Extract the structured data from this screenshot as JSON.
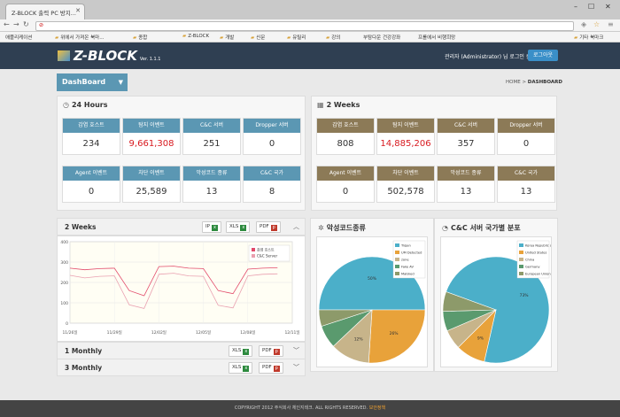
{
  "browser": {
    "tab_title": "Z-BLOCK 출력 PC 방지...",
    "address": "",
    "bookmarks": [
      {
        "label": "애플리케이션",
        "folder": false
      },
      {
        "label": "위에서 가져온 북마...",
        "folder": true
      },
      {
        "label": "종합",
        "folder": true
      },
      {
        "label": "Z-BLOCK",
        "folder": true
      },
      {
        "label": "개발",
        "folder": true
      },
      {
        "label": "신문",
        "folder": true
      },
      {
        "label": "유틸리",
        "folder": true
      },
      {
        "label": "강의",
        "folder": true
      },
      {
        "label": "부탐다운 건강강좌",
        "folder": false
      },
      {
        "label": "프롤에서 비행희망",
        "folder": false
      }
    ],
    "other_bookmarks": "기타 북마크"
  },
  "header": {
    "logo": "Z-BLOCK",
    "version": "Ver. 1.1.1",
    "admin_text": "관리자 (Administrator) 님 로그인 중",
    "logout_label": "로그아웃"
  },
  "nav": {
    "dashboard_label": "DashBoard",
    "breadcrumb_home": "HOME",
    "breadcrumb_sep": ">",
    "breadcrumb_current": "DASHBOARD"
  },
  "hours24": {
    "title": "24 Hours",
    "cards": [
      {
        "label": "감염 호스트",
        "value": "234",
        "red": false
      },
      {
        "label": "탐지 이벤트",
        "value": "9,661,308",
        "red": true
      },
      {
        "label": "C&C 서버",
        "value": "251",
        "red": false
      },
      {
        "label": "Dropper 서버",
        "value": "0",
        "red": false
      },
      {
        "label": "Agent 이벤트",
        "value": "0",
        "red": false
      },
      {
        "label": "차단 이벤트",
        "value": "25,589",
        "red": false
      },
      {
        "label": "악성코드 종류",
        "value": "13",
        "red": false
      },
      {
        "label": "C&C 국가",
        "value": "8",
        "red": false
      }
    ]
  },
  "weeks2": {
    "title": "2 Weeks",
    "cards": [
      {
        "label": "감염 호스트",
        "value": "808",
        "red": false
      },
      {
        "label": "탐지 이벤트",
        "value": "14,885,206",
        "red": true
      },
      {
        "label": "C&C 서버",
        "value": "357",
        "red": false
      },
      {
        "label": "Dropper 서버",
        "value": "0",
        "red": false
      },
      {
        "label": "Agent 이벤트",
        "value": "0",
        "red": false
      },
      {
        "label": "차단 이벤트",
        "value": "502,578",
        "red": false
      },
      {
        "label": "악성코드 종류",
        "value": "13",
        "red": false
      },
      {
        "label": "C&C 국가",
        "value": "13",
        "red": false
      }
    ]
  },
  "trend": {
    "title": "2 Weeks",
    "buttons": [
      "IP",
      "XLS",
      "PDF"
    ],
    "monthly1": "1 Monthly",
    "monthly3": "3 Monthly",
    "export_buttons": [
      "XLS",
      "PDF"
    ]
  },
  "chart_data": [
    {
      "type": "line",
      "x": [
        "11/26",
        "11/27",
        "11/28",
        "11/29",
        "11/30",
        "12/01",
        "12/02",
        "12/03",
        "12/04",
        "12/05",
        "12/06",
        "12/07",
        "12/08",
        "12/09",
        "12/10",
        "12/11"
      ],
      "xticks": [
        "11/26일",
        "11/29일",
        "12/02일",
        "12/05일",
        "12/08일",
        "12/11일"
      ],
      "ylim": [
        0,
        400
      ],
      "yticks": [
        0,
        100,
        200,
        300,
        400
      ],
      "grid": true,
      "legend": "top-right",
      "series": [
        {
          "name": "감염 호스트",
          "color": "#e24a6a",
          "values": [
            270,
            262,
            268,
            270,
            160,
            135,
            278,
            280,
            270,
            268,
            160,
            145,
            265,
            270,
            272,
            null
          ]
        },
        {
          "name": "C&C Server",
          "color": "#e9a0b0",
          "values": [
            235,
            222,
            230,
            232,
            90,
            72,
            240,
            245,
            232,
            230,
            88,
            75,
            232,
            240,
            242,
            null
          ]
        }
      ]
    },
    {
      "type": "pie",
      "title": "악성코드종류",
      "legend": "top-right",
      "slices": [
        {
          "label": "Trojan",
          "value": 50,
          "color": "#4bafc9"
        },
        {
          "label": "UM Detected",
          "value": 26,
          "color": "#e8a23a"
        },
        {
          "label": "zone",
          "value": 12,
          "color": "#c7b48a"
        },
        {
          "label": "Fake AV",
          "value": 7,
          "color": "#5a9a6e"
        },
        {
          "label": "Malsked",
          "value": 5,
          "color": "#8d9a6a"
        }
      ],
      "slice_labels": [
        "50%",
        "26%",
        "12%"
      ]
    },
    {
      "type": "pie",
      "title": "C&C 서버 국가별 분포",
      "legend": "top-right",
      "slices": [
        {
          "label": "Korea Republic of",
          "value": 73,
          "color": "#4bafc9"
        },
        {
          "label": "United States",
          "value": 9,
          "color": "#e8a23a"
        },
        {
          "label": "China",
          "value": 6,
          "color": "#c7b48a"
        },
        {
          "label": "Germany",
          "value": 6,
          "color": "#5a9a6e"
        },
        {
          "label": "European Union",
          "value": 6,
          "color": "#8d9a6a"
        }
      ],
      "slice_labels": [
        "73%",
        "9%"
      ]
    }
  ],
  "footer": {
    "text": "COPYRIGHT 2012 주식회사 체인지테크. ALL RIGHTS RESERVED.",
    "link": "보안정책"
  }
}
